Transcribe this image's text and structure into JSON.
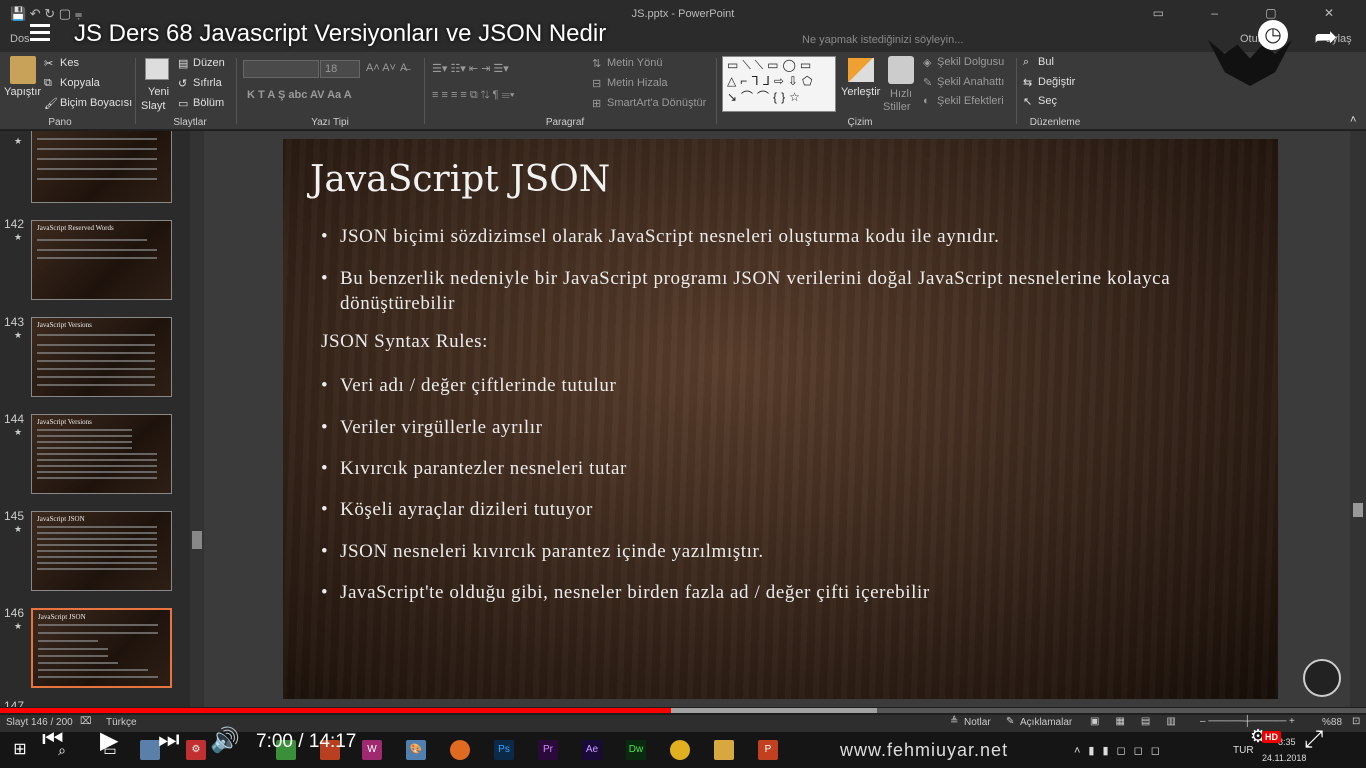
{
  "window": {
    "document_title": "JS.pptx - PowerPoint",
    "quick_access": "💾 ↶ ↻ ▢ ⩦"
  },
  "menu": {
    "file_tab": "Dos",
    "tell_me": "Ne yapmak istediğinizi söyleyin...",
    "share": "Oturu",
    "user": "aylaş"
  },
  "video": {
    "title": "JS Ders 68 Javascript Versiyonları ve JSON Nedir",
    "current_time": "7:00",
    "duration": "14:17",
    "hd_badge": "HD",
    "progress_fraction": 0.491,
    "buffer_fraction": 0.642
  },
  "ribbon": {
    "paste": "Yapıştır",
    "cut": "Kes",
    "copy": "Kopyala",
    "format_painter": "Biçim Boyacısı",
    "new_slide_1": "Yeni",
    "new_slide_2": "Slayt",
    "layout": "Düzen",
    "reset": "Sıfırla",
    "section": "Bölüm",
    "font_size": "18",
    "text_direction": "Metin Yönü",
    "align_text": "Metin Hizala",
    "smartart": "SmartArt'a Dönüştür",
    "arrange": "Yerleştir",
    "quick_styles_1": "Hızlı",
    "quick_styles_2": "Stiller",
    "shape_fill": "Şekil Dolgusu",
    "shape_outline": "Şekil Anahattı",
    "shape_effects": "Şekil Efektleri",
    "find": "Bul",
    "replace": "Değiştir",
    "select": "Seç",
    "groups": {
      "clipboard": "Pano",
      "slides": "Slaytlar",
      "font": "Yazı Tipi",
      "paragraph": "Paragraf",
      "drawing": "Çizim",
      "editing": "Düzenleme"
    },
    "font_buttons": "K  T  A  Ş  abc  AV  Aa  A"
  },
  "thumbnails": [
    {
      "num": "",
      "title": "",
      "top": 0
    },
    {
      "num": "142",
      "title": "JavaScript Reserved Words"
    },
    {
      "num": "143",
      "title": "JavaScript Versions"
    },
    {
      "num": "144",
      "title": "JavaScript Versions"
    },
    {
      "num": "145",
      "title": "JavaScript JSON"
    },
    {
      "num": "146",
      "title": "JavaScript JSON"
    },
    {
      "num": "147",
      "title": ""
    }
  ],
  "slide": {
    "title": "JavaScript JSON",
    "bullet_1": "JSON biçimi sözdizimsel olarak JavaScript nesneleri oluşturma kodu ile aynıdır.",
    "bullet_2": "Bu benzerlik nedeniyle bir JavaScript programı JSON verilerini doğal JavaScript nesnelerine kolayca dönüştürebilir",
    "rules_heading": "JSON Syntax Rules:",
    "rule_1": "Veri adı / değer çiftlerinde tutulur",
    "rule_2": "Veriler virgüllerle ayrılır",
    "rule_3": "Kıvırcık parantezler nesneleri tutar",
    "rule_4": "Köşeli ayraçlar dizileri tutuyor",
    "rule_5": "JSON nesneleri kıvırcık parantez içinde yazılmıştır.",
    "rule_6": "JavaScript'te olduğu gibi, nesneler birden fazla ad / değer çifti içerebilir",
    "bullet_char": "•"
  },
  "status": {
    "slide_info": "Slayt 146 / 200",
    "language": "Türkçe",
    "notes": "Notlar",
    "comments": "Açıklamalar",
    "zoom": "%88"
  },
  "taskbar": {
    "website": "www.fehmiuyar.net",
    "lang": "TUR",
    "date": "24.11.2018",
    "time": "8:35"
  }
}
